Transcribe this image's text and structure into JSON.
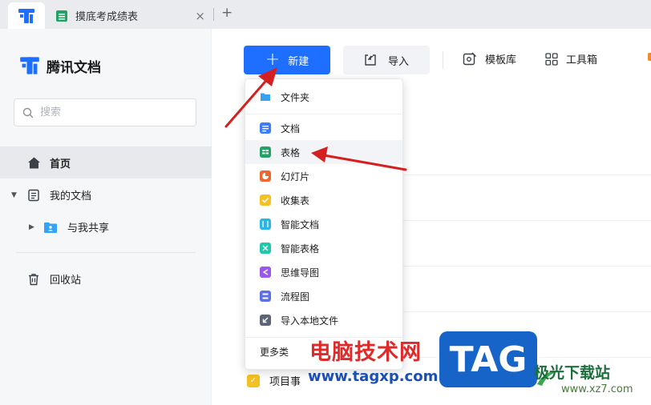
{
  "tabs": {
    "doc_title": "摸底考成绩表",
    "close_glyph": "×",
    "add_glyph": "+"
  },
  "brand": {
    "name": "腾讯文档"
  },
  "search": {
    "placeholder": "搜索"
  },
  "sidebar": {
    "home": "首页",
    "my_docs": "我的文档",
    "shared": "与我共享",
    "trash": "回收站"
  },
  "toolbar": {
    "new": "新建",
    "import": "导入",
    "template": "模板库",
    "toolbox": "工具箱"
  },
  "menu": {
    "folder": "文件夹",
    "doc": "文档",
    "sheet": "表格",
    "slides": "幻灯片",
    "form": "收集表",
    "smart_doc": "智能文档",
    "smart_sheet": "智能表格",
    "mindmap": "思维导图",
    "flowchart": "流程图",
    "import_local": "导入本地文件",
    "more": "更多类"
  },
  "list": {
    "bottom_item": "项目事"
  },
  "watermark": {
    "cn": "电脑技术网",
    "url": "www.tagxp.com",
    "tag": "TAG",
    "site": "极光下载站",
    "site_url": "www.xz7.com"
  },
  "colors": {
    "accent": "#1e6fff",
    "sheet_green": "#21a366",
    "doc_blue": "#3a7bff",
    "arrow_red": "#d42020"
  }
}
